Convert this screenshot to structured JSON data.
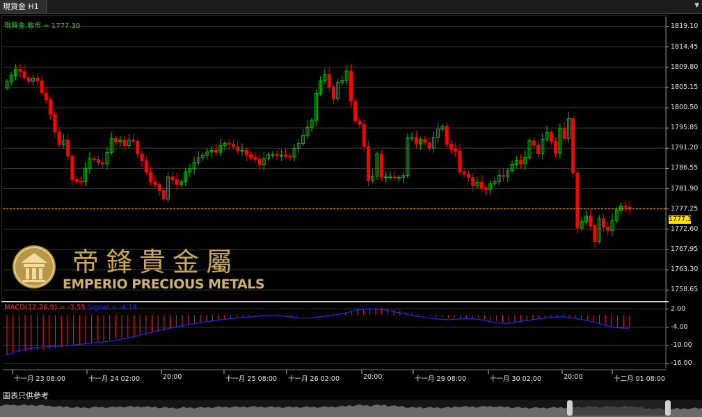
{
  "window": {
    "tab_title": "現貨金 H1",
    "menu_icon": "chevron-down-icon"
  },
  "legend": {
    "text": "現貨金.收市 = 1777.30"
  },
  "macd": {
    "label": "MACD(12,26,9) = -3.55",
    "signal": "Signal = -4.14"
  },
  "current_price": "1777.30",
  "disclaimer": "圖表只供參考",
  "logo": {
    "cn": "帝鋒貴金屬",
    "en": "EMPERIO PRECIOUS METALS"
  },
  "colors": {
    "up": "#00c000",
    "down": "#ff0000",
    "grid": "#3c3c3c",
    "price_line": "#ffb300",
    "macd_hist": "#ff2020",
    "signal": "#1a2cff"
  },
  "chart_data": {
    "type": "candlestick",
    "title": "現貨金 H1",
    "y_ticks": [
      "1819.10",
      "1814.45",
      "1809.80",
      "1805.15",
      "1800.50",
      "1795.85",
      "1791.20",
      "1786.55",
      "1781.90",
      "1777.25",
      "1772.60",
      "1767.95",
      "1763.30",
      "1758.65"
    ],
    "ylim": [
      1756.3,
      1821.4
    ],
    "x_labels": [
      "十一月 23 08:00",
      "十一月 24 02:00",
      "20:00",
      "十一月 25 08:00",
      "十一月 26 02:00",
      "20:00",
      "十一月 29 08:00",
      "十一月 30 02:00",
      "20:00",
      "十二月 01 08:00"
    ],
    "macd_ticks": [
      "2.00",
      "-4.00",
      "-10.00",
      "-16.00"
    ],
    "macd_ylim": [
      -17.5,
      3.5
    ],
    "close": [
      1806.5,
      1807.9,
      1809.3,
      1808.8,
      1807.4,
      1806.6,
      1807.3,
      1806.7,
      1803.9,
      1802.3,
      1799.0,
      1795.0,
      1792.0,
      1793.1,
      1789.4,
      1784.0,
      1783.6,
      1783.5,
      1786.6,
      1788.8,
      1788.6,
      1787.9,
      1787.6,
      1790.2,
      1793.4,
      1792.7,
      1793.1,
      1791.8,
      1793.1,
      1792.8,
      1789.9,
      1788.3,
      1785.7,
      1783.5,
      1782.9,
      1781.5,
      1779.6,
      1784.6,
      1784.0,
      1782.9,
      1783.5,
      1785.7,
      1786.5,
      1787.9,
      1789.0,
      1789.6,
      1790.4,
      1790.7,
      1790.3,
      1791.8,
      1792.3,
      1792.1,
      1791.5,
      1790.6,
      1790.7,
      1789.7,
      1789.1,
      1788.7,
      1787.5,
      1788.8,
      1789.7,
      1789.7,
      1789.6,
      1789.6,
      1789.4,
      1789.2,
      1791.2,
      1792.3,
      1794.2,
      1796.0,
      1797.6,
      1803.8,
      1806.7,
      1808.1,
      1805.3,
      1802.6,
      1806.3,
      1806.8,
      1808.9,
      1802.0,
      1797.5,
      1796.7,
      1791.6,
      1783.8,
      1784.8,
      1789.9,
      1784.6,
      1784.6,
      1784.6,
      1784.5,
      1784.5,
      1784.9,
      1793.6,
      1793.6,
      1792.2,
      1793.2,
      1792.5,
      1791.2,
      1793.7,
      1795.6,
      1796.2,
      1792.1,
      1791.0,
      1790.6,
      1785.8,
      1785.3,
      1784.5,
      1782.6,
      1783.4,
      1782.1,
      1781.8,
      1783.1,
      1783.5,
      1785.0,
      1784.7,
      1786.0,
      1787.5,
      1788.4,
      1787.6,
      1789.1,
      1792.9,
      1791.9,
      1790.0,
      1793.3,
      1794.8,
      1792.8,
      1790.1,
      1795.8,
      1793.4,
      1798.0,
      1785.5,
      1772.9,
      1774.4,
      1775.6,
      1773.4,
      1769.8,
      1775.0,
      1773.1,
      1772.3,
      1774.6,
      1777.0,
      1777.9,
      1777.7,
      1777.3
    ],
    "candle_count": 144,
    "macd_line": [
      -13.1,
      -12.4,
      -11.7,
      -11.2,
      -10.9,
      -10.7,
      -10.5,
      -10.3,
      -10.2,
      -10.2,
      -10.0,
      -9.8,
      -9.6,
      -9.4,
      -9.2,
      -9.0,
      -8.8,
      -8.6,
      -8.3,
      -7.9,
      -7.5,
      -7.1,
      -6.6,
      -6.1,
      -5.6,
      -5.1,
      -4.7,
      -4.3,
      -3.9,
      -3.5,
      -3.1,
      -2.8,
      -2.5,
      -2.2,
      -1.9,
      -1.6,
      -1.4,
      -1.2,
      -1.0,
      -0.8,
      -0.6,
      -0.5,
      -0.3,
      -0.2,
      -0.1,
      -0.2,
      -0.4,
      -0.6,
      -0.8,
      -1.0,
      -0.9,
      -0.7,
      -0.5,
      -0.3,
      0.0,
      0.3,
      0.7,
      1.2,
      1.7,
      2.0,
      2.1,
      2.0,
      1.8,
      1.5,
      1.1,
      0.7,
      0.3,
      -0.1,
      -0.4,
      -0.7,
      -1.0,
      -1.2,
      -1.4,
      -1.5,
      -1.4,
      -1.3,
      -1.2,
      -1.2,
      -1.4,
      -1.7,
      -2.1,
      -2.5,
      -2.7,
      -2.7,
      -2.4,
      -2.1,
      -1.8,
      -1.5,
      -1.2,
      -1.0,
      -0.8,
      -0.6,
      -0.6,
      -0.8,
      -1.1,
      -1.4,
      -1.8,
      -2.3,
      -2.8,
      -3.4,
      -3.9,
      -4.2,
      -4.3,
      -4.3
    ],
    "macd_hist": [
      -13,
      -12.5,
      -12,
      -11.8,
      -11.6,
      -11.4,
      -11.2,
      -11,
      -10.8,
      -10.6,
      -10.3,
      -10,
      -9.7,
      -9.4,
      -9.1,
      -8.8,
      -8.5,
      -8.2,
      -7.9,
      -7.6,
      -7.3,
      -7.0,
      -6.6,
      -6.2,
      -5.8,
      -5.4,
      -5.0,
      -4.6,
      -4.2,
      -3.8,
      -3.4,
      -3.0,
      -2.6,
      -2.2,
      -1.9,
      -1.6,
      -1.3,
      -1.0,
      -0.8,
      -0.6,
      -0.4,
      -0.3,
      -0.2,
      -0.1,
      -0.1,
      -0.2,
      -0.3,
      -0.4,
      -0.3,
      -0.2,
      -0.1,
      0,
      0.1,
      0.2,
      0.3,
      0.5,
      0.8,
      1.2,
      1.6,
      2.0,
      2.3,
      2.5,
      2.4,
      2.1,
      1.8,
      1.4,
      1.0,
      0.6,
      0.3,
      0,
      -0.3,
      -0.6,
      -0.8,
      -1.0,
      -1.1,
      -1.1,
      -1.0,
      -1.0,
      -1.1,
      -1.3,
      -1.6,
      -2.0,
      -2.3,
      -2.5,
      -2.5,
      -2.3,
      -2.0,
      -1.7,
      -1.4,
      -1.1,
      -0.9,
      -0.7,
      -0.6,
      -0.7,
      -0.9,
      -1.2,
      -1.6,
      -2.1,
      -2.6,
      -3.1,
      -3.6,
      -4.0,
      -4.2,
      -4.1
    ]
  }
}
